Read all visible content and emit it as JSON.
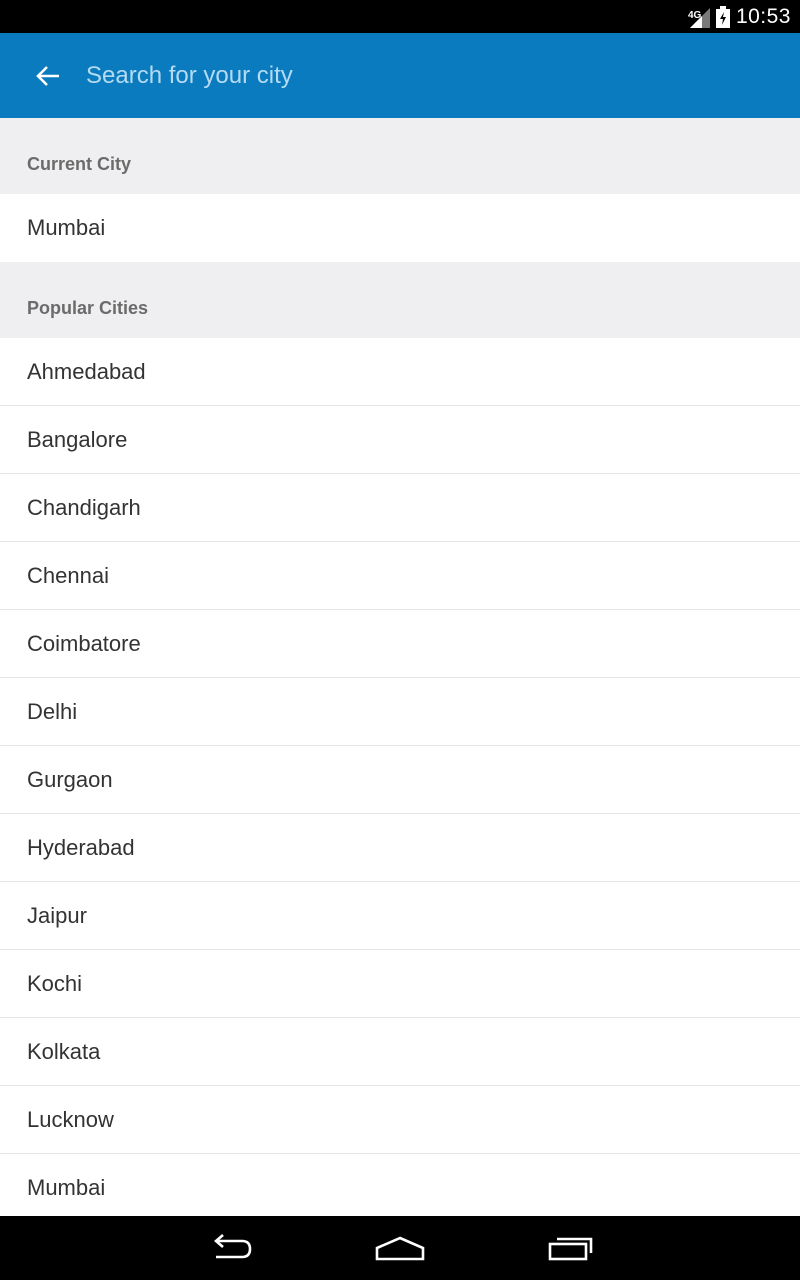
{
  "status_bar": {
    "time": "10:53",
    "network": "4G",
    "icons": [
      "signal-icon",
      "battery-icon"
    ]
  },
  "app_bar": {
    "back_icon": "arrow-back-icon",
    "search_placeholder": "Search for your city",
    "search_value": "",
    "background_color": "#0a7bbf"
  },
  "sections": {
    "current": {
      "header": "Current City",
      "cities": [
        "Mumbai"
      ]
    },
    "popular": {
      "header": "Popular Cities",
      "cities": [
        "Ahmedabad",
        "Bangalore",
        "Chandigarh",
        "Chennai",
        "Coimbatore",
        "Delhi",
        "Gurgaon",
        "Hyderabad",
        "Jaipur",
        "Kochi",
        "Kolkata",
        "Lucknow",
        "Mumbai"
      ]
    }
  },
  "nav_bar": {
    "icons": [
      "back-nav-icon",
      "home-nav-icon",
      "recents-nav-icon"
    ]
  }
}
